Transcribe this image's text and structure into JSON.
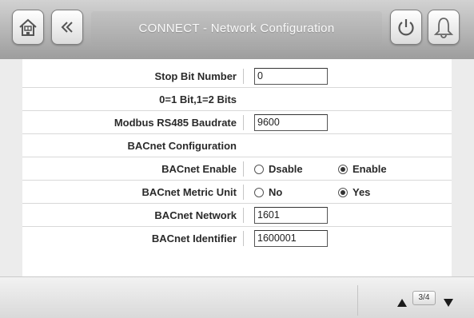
{
  "header": {
    "title": "CONNECT  - Network Configuration",
    "icons": [
      "home-icon",
      "back-icon",
      "power-icon",
      "alarm-bell-icon"
    ]
  },
  "rows": [
    {
      "label": "Stop Bit Number",
      "type": "input",
      "value": "0"
    },
    {
      "label": "0=1 Bit,1=2 Bits",
      "type": "text"
    },
    {
      "label": "Modbus RS485 Baudrate",
      "type": "input",
      "value": "9600"
    },
    {
      "label": "BACnet Configuration",
      "type": "text"
    },
    {
      "label": "BACnet Enable",
      "type": "radio",
      "options": [
        {
          "label": "Dsable",
          "checked": false
        },
        {
          "label": "Enable",
          "checked": true
        }
      ]
    },
    {
      "label": "BACnet Metric Unit",
      "type": "radio",
      "options": [
        {
          "label": "No",
          "checked": false
        },
        {
          "label": "Yes",
          "checked": true
        }
      ]
    },
    {
      "label": "BACnet Network",
      "type": "input",
      "value": "1601"
    },
    {
      "label": "BACnet Identifier",
      "type": "input",
      "value": "1600001"
    }
  ],
  "footer": {
    "page_indicator": "3/4"
  },
  "colors": {
    "header_bg": "#b8b8b8",
    "panel_bg": "#ffffff",
    "page_bg": "#ececec"
  }
}
